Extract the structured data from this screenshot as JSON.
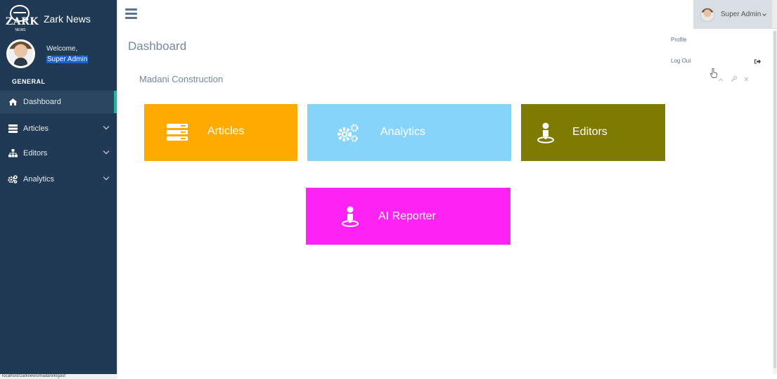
{
  "brand": {
    "title": "Zark News",
    "logo_text": "ZARK",
    "logo_subtext": "NEWS"
  },
  "profile": {
    "welcome": "Welcome,",
    "name": "Super Admin"
  },
  "sidebar": {
    "section_title": "GENERAL",
    "items": [
      {
        "label": "Dashboard",
        "icon": "home-icon",
        "active": true
      },
      {
        "label": "Articles",
        "icon": "server-icon",
        "has_submenu": true
      },
      {
        "label": "Editors",
        "icon": "sitemap-icon",
        "has_submenu": true
      },
      {
        "label": "Analytics",
        "icon": "cogs-icon",
        "has_submenu": true
      }
    ]
  },
  "status_url": "localhost/zarknews/madani/logout",
  "topbar": {
    "user_name": "Super Admin"
  },
  "dropdown": {
    "items": [
      {
        "label": "Profile"
      },
      {
        "label": "Log Out",
        "icon": "sign-out-icon"
      }
    ]
  },
  "page": {
    "title": "Dashboard"
  },
  "panel": {
    "title": "Madani Construction",
    "tools": [
      "collapse-icon",
      "wrench-icon",
      "close-icon"
    ]
  },
  "tiles": [
    {
      "label": "Articles",
      "icon": "server-icon",
      "color": "#FFAA00"
    },
    {
      "label": "Analytics",
      "icon": "cogs-icon",
      "color": "#87D4FB"
    },
    {
      "label": "Editors",
      "icon": "user-icon",
      "color": "#7F7A00"
    },
    {
      "label": "AI Reporter",
      "icon": "user-icon",
      "color": "#FF22F5"
    }
  ],
  "colors": {
    "sidebar": "#203A55",
    "active_border": "#1ABB9C",
    "text": "#73879C"
  }
}
